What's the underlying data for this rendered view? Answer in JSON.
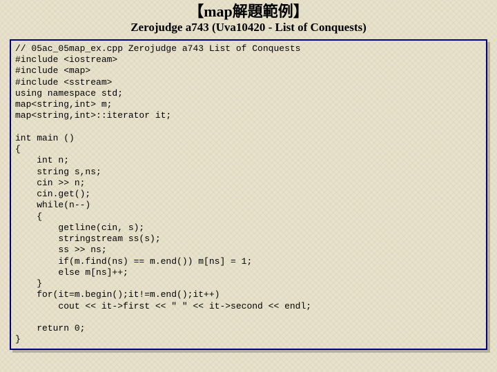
{
  "header": {
    "title": "【map解題範例】",
    "subtitle": "Zerojudge a743 (Uva10420 - List of Conquests)"
  },
  "code": {
    "lines": [
      "// 05ac_05map_ex.cpp Zerojudge a743 List of Conquests",
      "#include <iostream>",
      "#include <map>",
      "#include <sstream>",
      "using namespace std;",
      "map<string,int> m;",
      "map<string,int>::iterator it;",
      "",
      "int main ()",
      "{",
      "    int n;",
      "    string s,ns;",
      "    cin >> n;",
      "    cin.get();",
      "    while(n--)",
      "    {",
      "        getline(cin, s);",
      "        stringstream ss(s);",
      "        ss >> ns;",
      "        if(m.find(ns) == m.end()) m[ns] = 1;",
      "        else m[ns]++;",
      "    }",
      "    for(it=m.begin();it!=m.end();it++)",
      "        cout << it->first << \" \" << it->second << endl;",
      "",
      "    return 0;",
      "}"
    ]
  }
}
